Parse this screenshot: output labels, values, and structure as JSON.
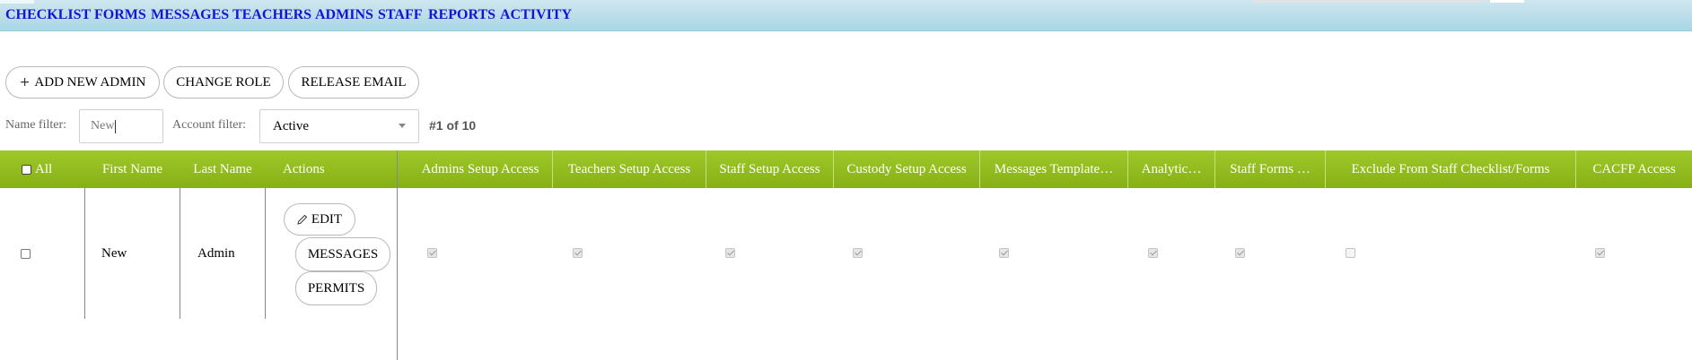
{
  "nav": {
    "items": [
      "CHECKLIST",
      "FORMS",
      "MESSAGES",
      "TEACHERS",
      "ADMINS",
      "STAFF",
      "REPORTS",
      "ACTIVITY"
    ]
  },
  "toolbar": {
    "add_admin_label": "ADD NEW ADMIN",
    "change_role_label": "CHANGE ROLE",
    "release_email_label": "RELEASE EMAIL"
  },
  "filters": {
    "name_label": "Name filter:",
    "name_value": "New",
    "account_label": "Account filter:",
    "account_value": "Active",
    "count": "#1 of 10"
  },
  "table": {
    "headers": {
      "all": "All",
      "first_name": "First Name",
      "last_name": "Last Name",
      "actions": "Actions",
      "admins_setup": "Admins Setup Access",
      "teachers_setup": "Teachers Setup Access",
      "staff_setup": "Staff Setup Access",
      "custody_setup": "Custody Setup Access",
      "messages_template": "Messages Template…",
      "analytics": "Analytic…",
      "staff_forms": "Staff Forms …",
      "exclude": "Exclude From Staff Checklist/Forms",
      "cacfp": "CACFP Access"
    },
    "rows": [
      {
        "first_name": "New",
        "last_name": "Admin",
        "actions": {
          "edit": "EDIT",
          "messages": "MESSAGES",
          "permits": "PERMITS"
        }
      }
    ]
  }
}
